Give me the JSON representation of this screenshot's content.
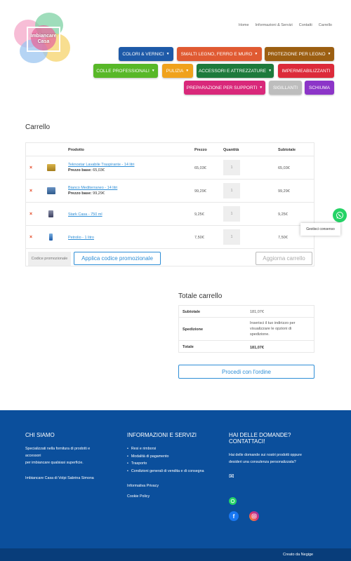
{
  "brand": {
    "logo_text": "Imbiancare Casa"
  },
  "top_nav": [
    "Home",
    "Informazioni & Servizi",
    "Contatti",
    "Carrello"
  ],
  "categories": [
    {
      "label": "COLORI & VERNICI",
      "color": "#1e5aa8"
    },
    {
      "label": "SMALTI LEGNO, FERRO E MURO",
      "color": "#e05a32"
    },
    {
      "label": "PROTEZIONE PER LEGNO",
      "color": "#9c5f12"
    },
    {
      "label": "COLLE PROFESSIONALI",
      "color": "#58b828"
    },
    {
      "label": "PULIZIA",
      "color": "#f0a21c"
    },
    {
      "label": "ACCESSORI E ATTREZZATURE",
      "color": "#1d7a3c"
    },
    {
      "label": "IMPERMEABILIZZANTI",
      "color": "#dc2b3a"
    },
    {
      "label": "PREPARAZIONE PER SUPPORTI",
      "color": "#d9287a"
    },
    {
      "label": "SIGILLANTI",
      "color": "#bdbdbd"
    },
    {
      "label": "SCHIUMA",
      "color": "#8c35c8"
    }
  ],
  "cart": {
    "title": "Carrello",
    "headers": {
      "product": "Prodotto",
      "price": "Prezzo",
      "qty": "Quantità",
      "subtotal": "Subtotale"
    },
    "items": [
      {
        "name": "Teknostar Lavabile Traspirante - 14 litri",
        "base_label": "Prezzo base:",
        "base_price": "65,03€",
        "price": "65,03€",
        "qty": "1",
        "subtotal": "65,03€"
      },
      {
        "name": "Bianco Mediterraneo - 14 litri",
        "base_label": "Prezzo base:",
        "base_price": "99,29€",
        "price": "99,29€",
        "qty": "1",
        "subtotal": "99,29€"
      },
      {
        "name": "Stark Casa - 750 ml",
        "price": "9,25€",
        "qty": "1",
        "subtotal": "9,25€"
      },
      {
        "name": "Petrolio - 1 litro",
        "price": "7,50€",
        "qty": "1",
        "subtotal": "7,50€"
      }
    ],
    "coupon_placeholder": "Codice promozionale",
    "apply_coupon": "Applica codice promozionale",
    "update_cart": "Aggiorna carrello"
  },
  "totals": {
    "title": "Totale carrello",
    "subtotal_label": "Subtotale",
    "subtotal_value": "181,07€",
    "shipping_label": "Spedizione",
    "shipping_text": "Inserisci il tuo indirizzo per visualizzare le opzioni di spedizione.",
    "total_label": "Totale",
    "total_value": "181,07€",
    "checkout": "Procedi con l'ordine"
  },
  "consent": "Gestisci consenso",
  "footer": {
    "about_title": "CHI SIAMO",
    "about_line1": "Specializzati nella fornitura di prodotti e",
    "about_line2": "accessori",
    "about_line3": "per imbiancare qualsiasi superficie.",
    "company": "Imbiancare Casa di Volpi Sabrina Simona",
    "info_title": "INFORMAZIONI E SERVIZI",
    "info_items": [
      "Resi e rimborsi",
      "Modalità di pagamento",
      "Trasporto",
      "Condizioni generali di vendita e di consegna"
    ],
    "privacy": "Informativa Privacy",
    "cookie": "Cookie Policy",
    "contact_title_1": "HAI DELLE DOMANDE?",
    "contact_title_2": "CONTATTACI!",
    "contact_line1": "Hai delle domande sui nostri prodotti oppure",
    "contact_line2": "desideri una consulenza personalizzata?",
    "credit": "Creato da Negige"
  },
  "icons": {
    "remove": "×",
    "chevron": "⌄",
    "email": "✉",
    "whatsapp": "whatsapp-icon",
    "facebook": "f",
    "instagram": "instagram-icon"
  }
}
